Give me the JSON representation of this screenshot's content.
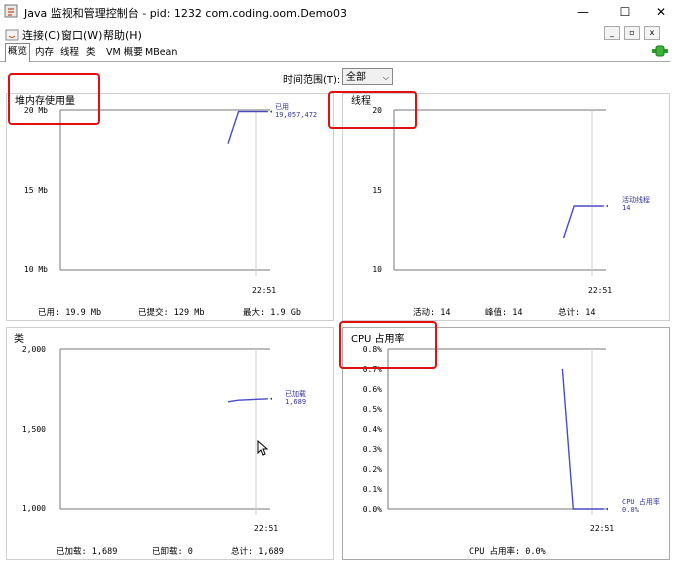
{
  "window": {
    "title": "Java 监视和管理控制台 - pid: 1232 com.coding.oom.Demo03",
    "minimize": "—",
    "maximize": "☐",
    "close": "✕"
  },
  "menu": {
    "items": [
      "连接(C)",
      "窗口(W)",
      "帮助(H)"
    ],
    "mini_buttons": [
      "_",
      "▫",
      "x"
    ]
  },
  "tabs": [
    "概览",
    "内存",
    "线程",
    "类",
    "VM 概要",
    "MBean"
  ],
  "time_range": {
    "label": "时间范围(T):",
    "value": "全部"
  },
  "panels": {
    "heap": {
      "title": "堆内存使用量",
      "yticks": [
        "20 Mb",
        "15 Mb",
        "10 Mb"
      ],
      "xtick": "22:51",
      "legend_name": "已用",
      "legend_value": "19,057,472",
      "footer": [
        "已用:  19.9  Mb",
        "已提交:  129  Mb",
        "最大:  1.9  Gb"
      ]
    },
    "threads": {
      "title": "线程",
      "yticks": [
        "20",
        "15",
        "10"
      ],
      "xtick": "22:51",
      "legend_name": "活动线程",
      "legend_value": "14",
      "footer": [
        "活动:  14",
        "峰值:  14",
        "总计:  14"
      ]
    },
    "classes": {
      "title": "类",
      "yticks": [
        "2,000",
        "1,500",
        "1,000"
      ],
      "xtick": "22:51",
      "legend_name": "已加载",
      "legend_value": "1,689",
      "footer": [
        "已加载:  1,689",
        "已卸载:  0",
        "总计:  1,689"
      ]
    },
    "cpu": {
      "title": "CPU 占用率",
      "yticks": [
        "0.8%",
        "0.7%",
        "0.6%",
        "0.5%",
        "0.4%",
        "0.3%",
        "0.2%",
        "0.1%",
        "0.0%"
      ],
      "xtick": "22:51",
      "legend_name": "CPU 占用率",
      "legend_value": "0.0%",
      "footer": [
        "CPU 占用率:  0.0%"
      ]
    }
  },
  "chart_data": [
    {
      "type": "line",
      "title": "堆内存使用量",
      "ylim": [
        10,
        20
      ],
      "yunit": "Mb",
      "x": [
        "",
        "",
        "22:51"
      ],
      "series": [
        {
          "name": "已用",
          "values": [
            17.9,
            19.9,
            19.9
          ]
        }
      ]
    },
    {
      "type": "line",
      "title": "线程",
      "ylim": [
        10,
        20
      ],
      "x": [
        "",
        "",
        "22:51"
      ],
      "series": [
        {
          "name": "活动线程",
          "values": [
            12,
            14,
            14
          ]
        }
      ]
    },
    {
      "type": "line",
      "title": "类",
      "ylim": [
        1000,
        2000
      ],
      "x": [
        "",
        "",
        "22:51"
      ],
      "series": [
        {
          "name": "已加载",
          "values": [
            1670,
            1680,
            1689
          ]
        }
      ]
    },
    {
      "type": "line",
      "title": "CPU 占用率",
      "ylim": [
        0,
        0.8
      ],
      "yunit": "%",
      "x": [
        "",
        "",
        "22:51"
      ],
      "series": [
        {
          "name": "CPU 占用率",
          "values": [
            0.7,
            0.0,
            0.0
          ]
        }
      ]
    }
  ],
  "colors": {
    "line": "#4a4ac8",
    "highlight_box": "#e01010",
    "connection_icon": "#2e9b2e"
  }
}
